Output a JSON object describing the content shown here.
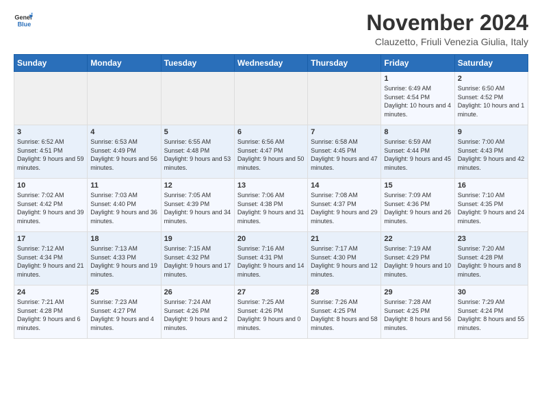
{
  "header": {
    "logo_line1": "General",
    "logo_line2": "Blue",
    "month_title": "November 2024",
    "location": "Clauzetto, Friuli Venezia Giulia, Italy"
  },
  "days_of_week": [
    "Sunday",
    "Monday",
    "Tuesday",
    "Wednesday",
    "Thursday",
    "Friday",
    "Saturday"
  ],
  "weeks": [
    [
      {
        "day": "",
        "info": ""
      },
      {
        "day": "",
        "info": ""
      },
      {
        "day": "",
        "info": ""
      },
      {
        "day": "",
        "info": ""
      },
      {
        "day": "",
        "info": ""
      },
      {
        "day": "1",
        "info": "Sunrise: 6:49 AM\nSunset: 4:54 PM\nDaylight: 10 hours and 4 minutes."
      },
      {
        "day": "2",
        "info": "Sunrise: 6:50 AM\nSunset: 4:52 PM\nDaylight: 10 hours and 1 minute."
      }
    ],
    [
      {
        "day": "3",
        "info": "Sunrise: 6:52 AM\nSunset: 4:51 PM\nDaylight: 9 hours and 59 minutes."
      },
      {
        "day": "4",
        "info": "Sunrise: 6:53 AM\nSunset: 4:49 PM\nDaylight: 9 hours and 56 minutes."
      },
      {
        "day": "5",
        "info": "Sunrise: 6:55 AM\nSunset: 4:48 PM\nDaylight: 9 hours and 53 minutes."
      },
      {
        "day": "6",
        "info": "Sunrise: 6:56 AM\nSunset: 4:47 PM\nDaylight: 9 hours and 50 minutes."
      },
      {
        "day": "7",
        "info": "Sunrise: 6:58 AM\nSunset: 4:45 PM\nDaylight: 9 hours and 47 minutes."
      },
      {
        "day": "8",
        "info": "Sunrise: 6:59 AM\nSunset: 4:44 PM\nDaylight: 9 hours and 45 minutes."
      },
      {
        "day": "9",
        "info": "Sunrise: 7:00 AM\nSunset: 4:43 PM\nDaylight: 9 hours and 42 minutes."
      }
    ],
    [
      {
        "day": "10",
        "info": "Sunrise: 7:02 AM\nSunset: 4:42 PM\nDaylight: 9 hours and 39 minutes."
      },
      {
        "day": "11",
        "info": "Sunrise: 7:03 AM\nSunset: 4:40 PM\nDaylight: 9 hours and 36 minutes."
      },
      {
        "day": "12",
        "info": "Sunrise: 7:05 AM\nSunset: 4:39 PM\nDaylight: 9 hours and 34 minutes."
      },
      {
        "day": "13",
        "info": "Sunrise: 7:06 AM\nSunset: 4:38 PM\nDaylight: 9 hours and 31 minutes."
      },
      {
        "day": "14",
        "info": "Sunrise: 7:08 AM\nSunset: 4:37 PM\nDaylight: 9 hours and 29 minutes."
      },
      {
        "day": "15",
        "info": "Sunrise: 7:09 AM\nSunset: 4:36 PM\nDaylight: 9 hours and 26 minutes."
      },
      {
        "day": "16",
        "info": "Sunrise: 7:10 AM\nSunset: 4:35 PM\nDaylight: 9 hours and 24 minutes."
      }
    ],
    [
      {
        "day": "17",
        "info": "Sunrise: 7:12 AM\nSunset: 4:34 PM\nDaylight: 9 hours and 21 minutes."
      },
      {
        "day": "18",
        "info": "Sunrise: 7:13 AM\nSunset: 4:33 PM\nDaylight: 9 hours and 19 minutes."
      },
      {
        "day": "19",
        "info": "Sunrise: 7:15 AM\nSunset: 4:32 PM\nDaylight: 9 hours and 17 minutes."
      },
      {
        "day": "20",
        "info": "Sunrise: 7:16 AM\nSunset: 4:31 PM\nDaylight: 9 hours and 14 minutes."
      },
      {
        "day": "21",
        "info": "Sunrise: 7:17 AM\nSunset: 4:30 PM\nDaylight: 9 hours and 12 minutes."
      },
      {
        "day": "22",
        "info": "Sunrise: 7:19 AM\nSunset: 4:29 PM\nDaylight: 9 hours and 10 minutes."
      },
      {
        "day": "23",
        "info": "Sunrise: 7:20 AM\nSunset: 4:28 PM\nDaylight: 9 hours and 8 minutes."
      }
    ],
    [
      {
        "day": "24",
        "info": "Sunrise: 7:21 AM\nSunset: 4:28 PM\nDaylight: 9 hours and 6 minutes."
      },
      {
        "day": "25",
        "info": "Sunrise: 7:23 AM\nSunset: 4:27 PM\nDaylight: 9 hours and 4 minutes."
      },
      {
        "day": "26",
        "info": "Sunrise: 7:24 AM\nSunset: 4:26 PM\nDaylight: 9 hours and 2 minutes."
      },
      {
        "day": "27",
        "info": "Sunrise: 7:25 AM\nSunset: 4:26 PM\nDaylight: 9 hours and 0 minutes."
      },
      {
        "day": "28",
        "info": "Sunrise: 7:26 AM\nSunset: 4:25 PM\nDaylight: 8 hours and 58 minutes."
      },
      {
        "day": "29",
        "info": "Sunrise: 7:28 AM\nSunset: 4:25 PM\nDaylight: 8 hours and 56 minutes."
      },
      {
        "day": "30",
        "info": "Sunrise: 7:29 AM\nSunset: 4:24 PM\nDaylight: 8 hours and 55 minutes."
      }
    ]
  ]
}
